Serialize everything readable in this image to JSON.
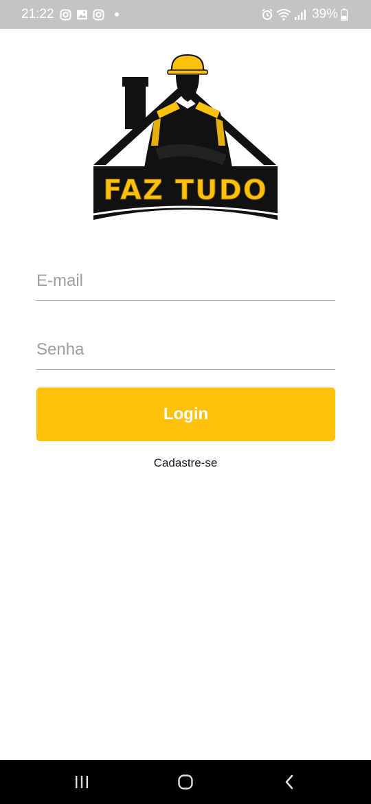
{
  "status_bar": {
    "time": "21:22",
    "battery": "39%",
    "left_icons": [
      "instagram-icon",
      "gallery-icon",
      "instagram-icon"
    ],
    "right_icons": [
      "alarm-icon",
      "wifi-icon",
      "signal-icon",
      "battery-icon"
    ]
  },
  "logo": {
    "text": "FAZ TUDO",
    "colors": {
      "black": "#111111",
      "yellow": "#fdc10c"
    }
  },
  "login_form": {
    "email_placeholder": "E-mail",
    "email_value": "",
    "password_placeholder": "Senha",
    "password_value": "",
    "login_label": "Login",
    "signup_label": "Cadastre-se"
  },
  "theme": {
    "accent": "#fdc10c",
    "status_bar_bg": "#c4c4c4",
    "nav_bar_bg": "#000000"
  },
  "nav_bar": {
    "buttons": [
      "recent-apps-icon",
      "home-icon",
      "back-icon"
    ]
  }
}
